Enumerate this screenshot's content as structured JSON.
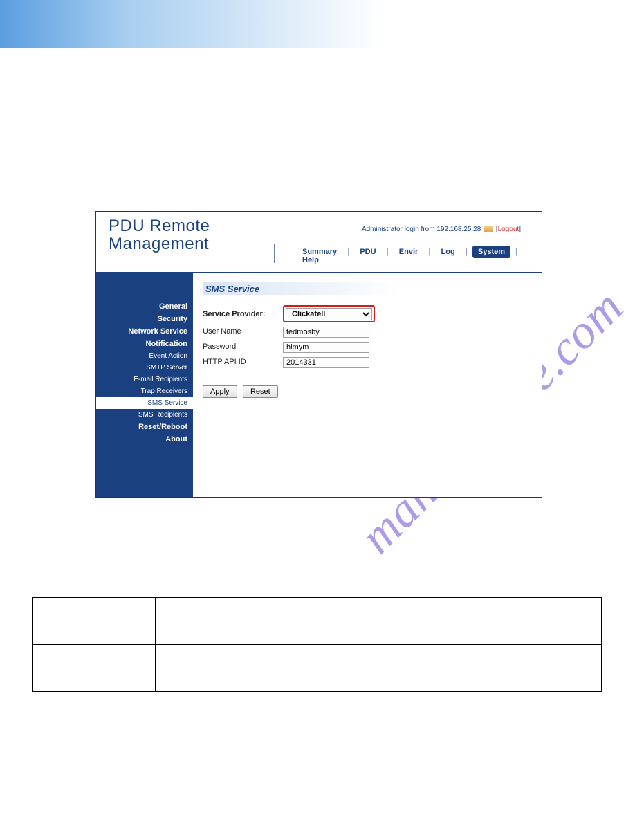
{
  "header": {
    "app_title_line1": "PDU Remote",
    "app_title_line2": "Management",
    "login_prefix": "Administrator login from ",
    "login_ip": "192.168.25.28",
    "logout_label": "Logout"
  },
  "nav": {
    "items": [
      "Summary",
      "PDU",
      "Envir",
      "Log",
      "System",
      "Help"
    ],
    "active_index": 4
  },
  "sidebar": {
    "items": [
      {
        "label": "General",
        "bold": true
      },
      {
        "label": "Security",
        "bold": true
      },
      {
        "label": "Network Service",
        "bold": true
      },
      {
        "label": "Notification",
        "bold": true
      },
      {
        "label": "Event Action",
        "bold": false
      },
      {
        "label": "SMTP Server",
        "bold": false
      },
      {
        "label": "E-mail Recipients",
        "bold": false
      },
      {
        "label": "Trap Receivers",
        "bold": false
      },
      {
        "label": "SMS Service",
        "bold": false,
        "active": true
      },
      {
        "label": "SMS Recipients",
        "bold": false
      },
      {
        "label": "Reset/Reboot",
        "bold": true
      },
      {
        "label": "About",
        "bold": true
      }
    ]
  },
  "panel": {
    "title": "SMS Service",
    "provider_label": "Service Provider:",
    "provider_value": "Clickatell",
    "username_label": "User Name",
    "username_value": "tedmosby",
    "password_label": "Password",
    "password_value": "himym",
    "apiid_label": "HTTP API ID",
    "apiid_value": "2014331",
    "apply_label": "Apply",
    "reset_label": "Reset"
  },
  "watermark": "manualshive.com",
  "table": {
    "rows": [
      [
        "",
        ""
      ],
      [
        "",
        ""
      ],
      [
        "",
        ""
      ],
      [
        "",
        ""
      ]
    ]
  }
}
